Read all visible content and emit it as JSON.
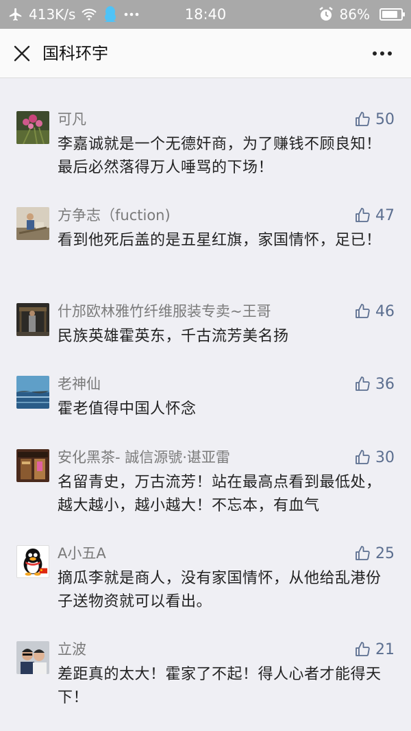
{
  "status_bar": {
    "net_speed": "413K/s",
    "time": "18:40",
    "battery": "86%",
    "battery_level": 0.86
  },
  "nav": {
    "title": "国科环宇",
    "close_icon": "close-icon",
    "more_icon": "more-icon"
  },
  "comments": [
    {
      "name": "可凡",
      "likes": "50",
      "text": "李嘉诚就是一个无德奸商，为了赚钱不顾良知！最后必然落得万人唾骂的下场！"
    },
    {
      "name": "方争志（fuction)",
      "likes": "47",
      "text": "看到他死后盖的是五星红旗，家国情怀，足已！"
    },
    {
      "name": "什邡欧林雅竹纤维服装专卖~王哥",
      "likes": "46",
      "text": "民族英雄霍英东，千古流芳美名扬"
    },
    {
      "name": "老神仙",
      "likes": "36",
      "text": "霍老值得中国人怀念"
    },
    {
      "name": "安化黑茶- 誠信源號·谌亚雷",
      "likes": "30",
      "text": "名留青史，万古流芳！站在最高点看到最低处，越大越小，越小越大！不忘本，有血气"
    },
    {
      "name": "A小五A",
      "likes": "25",
      "text": "摘瓜李就是商人，没有家国情怀，从他给乱港份子送物资就可以看出。"
    },
    {
      "name": "立波",
      "likes": "21",
      "text": "差距真的太大！霍家了不起！得人心者才能得天下！"
    }
  ]
}
